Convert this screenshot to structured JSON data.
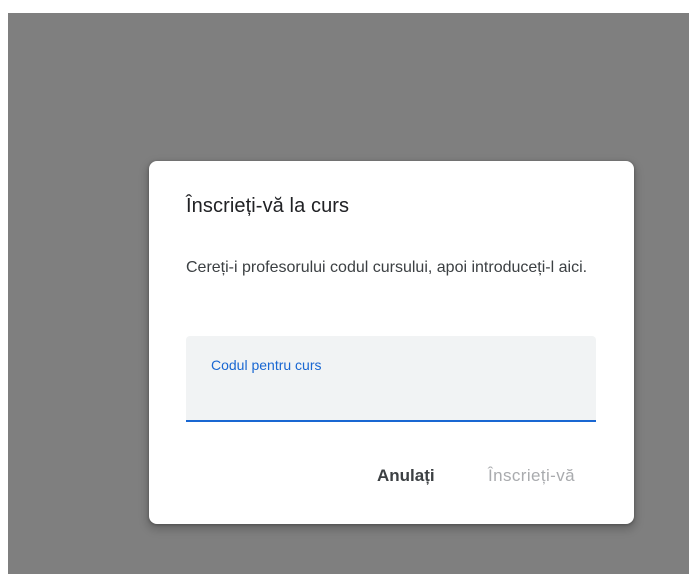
{
  "dialog": {
    "title": "Înscrieți-vă la curs",
    "body": "Cereți-i profesorului codul cursului, apoi introduceți-l aici.",
    "field": {
      "label": "Codul pentru curs",
      "value": ""
    },
    "actions": {
      "cancel_label": "Anulați",
      "join_label": "Înscrieți-vă"
    }
  },
  "colors": {
    "overlay": "#7f7f7f",
    "accent": "#1967d2",
    "disabled_text": "#a9abae"
  }
}
